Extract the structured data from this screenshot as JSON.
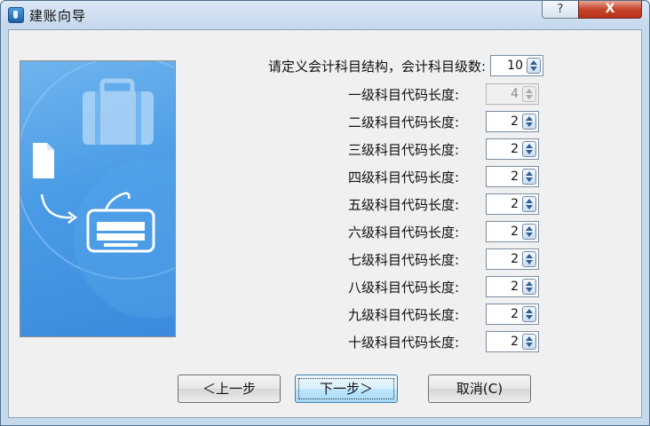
{
  "window": {
    "title": "建账向导"
  },
  "titlebar": {
    "help_label": "?",
    "close_label": "X"
  },
  "header": {
    "label": "请定义会计科目结构，会计科目级数:",
    "levels_value": "10"
  },
  "levels": [
    {
      "label": "一级科目代码长度:",
      "value": "4",
      "disabled": true
    },
    {
      "label": "二级科目代码长度:",
      "value": "2"
    },
    {
      "label": "三级科目代码长度:",
      "value": "2"
    },
    {
      "label": "四级科目代码长度:",
      "value": "2"
    },
    {
      "label": "五级科目代码长度:",
      "value": "2"
    },
    {
      "label": "六级科目代码长度:",
      "value": "2"
    },
    {
      "label": "七级科目代码长度:",
      "value": "2"
    },
    {
      "label": "八级科目代码长度:",
      "value": "2"
    },
    {
      "label": "九级科目代码长度:",
      "value": "2"
    },
    {
      "label": "十级科目代码长度:",
      "value": "2"
    }
  ],
  "buttons": {
    "prev": "＜上一步",
    "next": "下一步＞",
    "cancel": "取消(C)"
  },
  "colors": {
    "panel_blue": "#4b9ce6",
    "close_red": "#c7442c"
  }
}
